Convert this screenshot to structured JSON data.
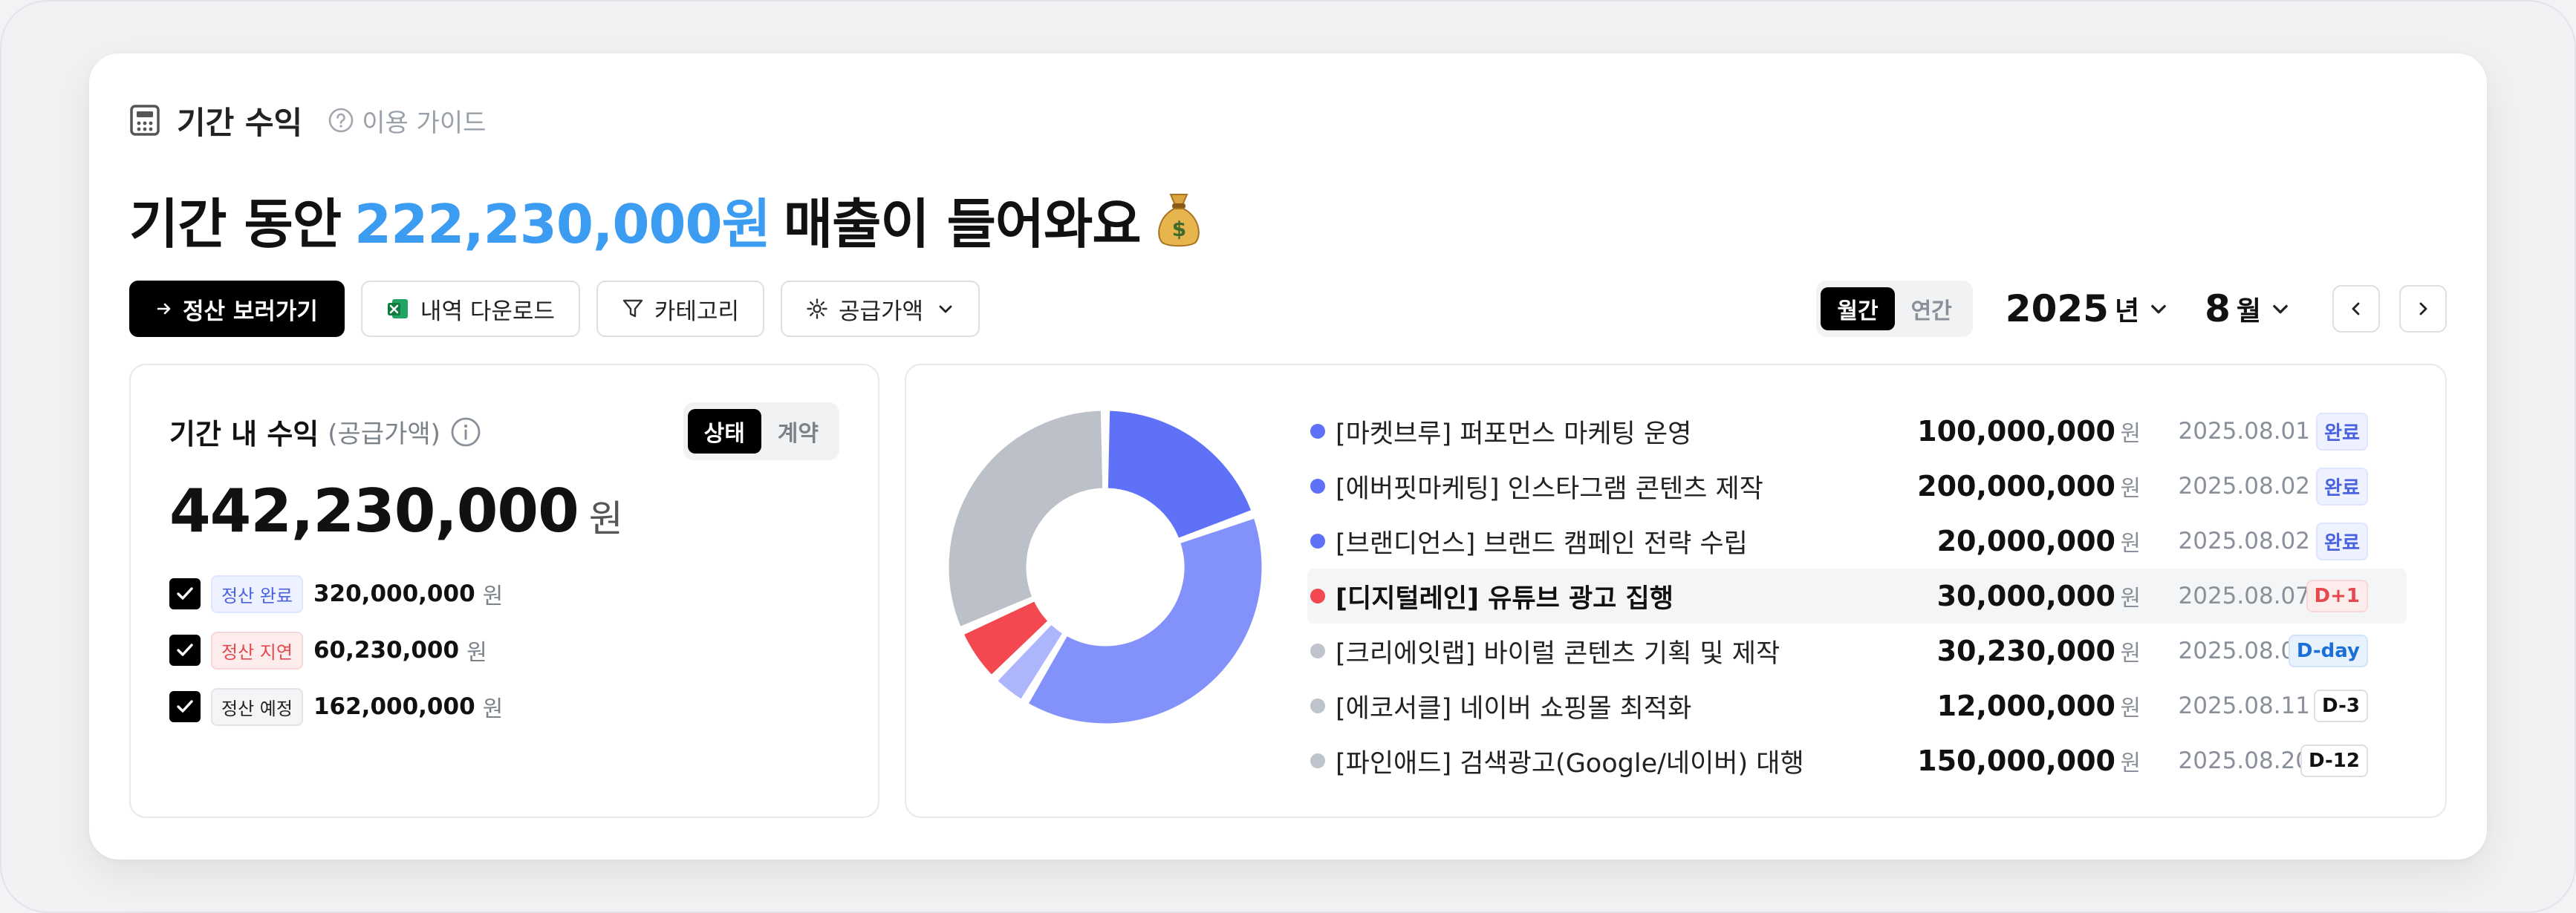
{
  "header": {
    "section_title": "기간 수익",
    "guide_label": "이용 가이드"
  },
  "headline": {
    "prefix": "기간 동안",
    "amount": "222,230,000원",
    "suffix": "매출이 들어와요"
  },
  "toolbar": {
    "settle_label": "정산 보러가기",
    "download_label": "내역 다운로드",
    "category_label": "카테고리",
    "supply_label": "공급가액"
  },
  "period": {
    "monthly_label": "월간",
    "yearly_label": "연간",
    "year": "2025",
    "year_unit": "년",
    "month": "8",
    "month_unit": "월"
  },
  "summary": {
    "title": "기간 내 수익",
    "subtitle": "(공급가액)",
    "toggle_status": "상태",
    "toggle_contract": "계약",
    "total": "442,230,000",
    "total_unit": "원",
    "rows": [
      {
        "badge": "정산 완료",
        "amount": "320,000,000",
        "unit": "원"
      },
      {
        "badge": "정산 지연",
        "amount": "60,230,000",
        "unit": "원"
      },
      {
        "badge": "정산 예정",
        "amount": "162,000,000",
        "unit": "원"
      }
    ]
  },
  "items": [
    {
      "name": "[마켓브루] 퍼포먼스 마케팅 운영",
      "amount": "100,000,000",
      "unit": "원",
      "date": "2025.08.01",
      "badge": "완료"
    },
    {
      "name": "[에버핏마케팅] 인스타그램 콘텐츠 제작",
      "amount": "200,000,000",
      "unit": "원",
      "date": "2025.08.02",
      "badge": "완료"
    },
    {
      "name": "[브랜디언스] 브랜드 캠페인 전략 수립",
      "amount": "20,000,000",
      "unit": "원",
      "date": "2025.08.02",
      "badge": "완료"
    },
    {
      "name": "[디지털레인] 유튜브 광고 집행",
      "amount": "30,000,000",
      "unit": "원",
      "date": "2025.08.07",
      "badge": "D+1"
    },
    {
      "name": "[크리에잇랩] 바이럴 콘텐츠 기획 및 제작",
      "amount": "30,230,000",
      "unit": "원",
      "date": "2025.08.08",
      "badge": "D-day"
    },
    {
      "name": "[에코서클] 네이버 쇼핑몰 최적화",
      "amount": "12,000,000",
      "unit": "원",
      "date": "2025.08.11",
      "badge": "D-3"
    },
    {
      "name": "[파인애드] 검색광고(Google/네이버) 대행",
      "amount": "150,000,000",
      "unit": "원",
      "date": "2025.08.20",
      "badge": "D-12"
    }
  ],
  "colors": {
    "accent_blue": "#3b9cf2",
    "done": "#5f72f7",
    "late": "#f3484f",
    "scheduled": "#bfc3cb"
  },
  "chart_data": {
    "type": "pie",
    "donut": true,
    "slices": [
      {
        "category": "정산 완료",
        "value": 320000000,
        "color": "#5f72f7"
      },
      {
        "category": "정산 완료",
        "value": 100000000,
        "color": "#5f72f7"
      },
      {
        "category": "정산 완료",
        "value": 200000000,
        "color": "#8391fb"
      },
      {
        "category": "정산 완료",
        "value": 20000000,
        "color": "#adb6fd"
      },
      {
        "category": "정산 지연",
        "value": 30000000,
        "color": "#f3484f"
      },
      {
        "category": "정산 예정",
        "value": 162000000,
        "color": "#bcc0c8"
      }
    ]
  }
}
